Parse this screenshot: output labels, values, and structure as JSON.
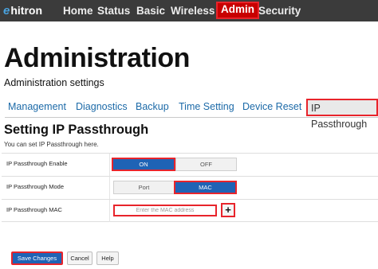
{
  "brand": {
    "logo_mark": "e",
    "logo_text": "hitron"
  },
  "nav": {
    "items": [
      {
        "label": "Home"
      },
      {
        "label": "Status"
      },
      {
        "label": "Basic"
      },
      {
        "label": "Wireless"
      },
      {
        "label": "Admin",
        "active": true
      },
      {
        "label": "Security"
      }
    ]
  },
  "page": {
    "title": "Administration",
    "subtitle": "Administration settings"
  },
  "tabs": [
    {
      "label": "Management"
    },
    {
      "label": "Diagnostics"
    },
    {
      "label": "Backup"
    },
    {
      "label": "Time Setting"
    },
    {
      "label": "Device Reset"
    },
    {
      "label": "IP Passthrough",
      "active": true
    }
  ],
  "section": {
    "title": "Setting IP Passthrough",
    "description": "You can set IP Passthrough here."
  },
  "form": {
    "enable": {
      "label": "IP Passthrough Enable",
      "on_label": "ON",
      "off_label": "OFF",
      "value": "ON"
    },
    "mode": {
      "label": "IP Passthrough Mode",
      "port_label": "Port",
      "mac_label": "MAC",
      "value": "MAC"
    },
    "mac": {
      "label": "IP Passthrough MAC",
      "placeholder": "Enter the MAC address",
      "value": "",
      "add_label": "+"
    }
  },
  "footer": {
    "save_label": "Save Changes",
    "cancel_label": "Cancel",
    "help_label": "Help"
  },
  "colors": {
    "topbar": "#3b3b3b",
    "accent_blue": "#1f63b5",
    "highlight_red": "#e8242b",
    "tab_link": "#1c6aa8"
  }
}
